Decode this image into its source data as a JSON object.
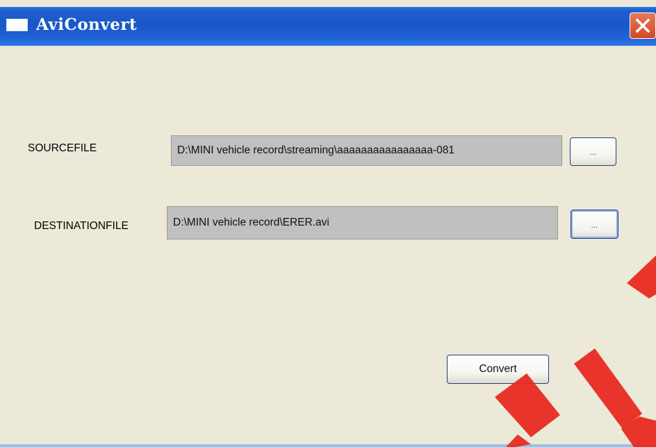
{
  "window": {
    "title": "AviConvert",
    "close_icon": "close-icon",
    "app_icon": "app-window-icon"
  },
  "source": {
    "label": "SOURCEFILE",
    "value": "D:\\MINI vehicle record\\streaming\\aaaaaaaaaaaaaaaa-081",
    "browse_label": "..."
  },
  "destination": {
    "label": "DESTINATIONFILE",
    "value": "D:\\MINI vehicle record\\ERER.avi",
    "browse_label": "..."
  },
  "actions": {
    "convert_label": "Convert"
  },
  "colors": {
    "titlebar": "#1957c6",
    "window_bg": "#ece9d8",
    "field_bg": "#c0c0c0",
    "close_button": "#d34a25",
    "watermark": "#e8251c"
  }
}
